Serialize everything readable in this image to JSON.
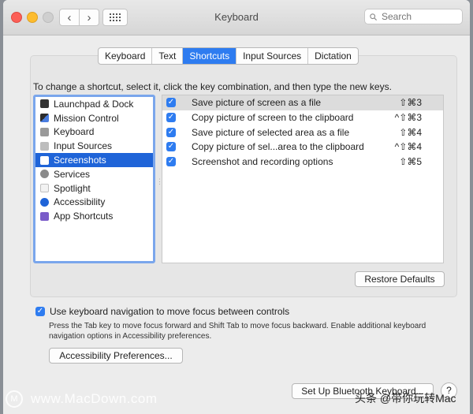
{
  "window": {
    "title": "Keyboard"
  },
  "search": {
    "placeholder": "Search"
  },
  "tabs": [
    {
      "label": "Keyboard"
    },
    {
      "label": "Text"
    },
    {
      "label": "Shortcuts"
    },
    {
      "label": "Input Sources"
    },
    {
      "label": "Dictation"
    }
  ],
  "instruction": "To change a shortcut, select it, click the key combination, and then type the new keys.",
  "categories": [
    {
      "label": "Launchpad & Dock",
      "icon": "launchpad-icon",
      "color": "#333333"
    },
    {
      "label": "Mission Control",
      "icon": "mission-control-icon",
      "color": "#2b2b2b"
    },
    {
      "label": "Keyboard",
      "icon": "keyboard-icon",
      "color": "#9a9a9a"
    },
    {
      "label": "Input Sources",
      "icon": "input-sources-icon",
      "color": "#bdbdbd"
    },
    {
      "label": "Screenshots",
      "icon": "screenshots-icon",
      "color": "#ffffff"
    },
    {
      "label": "Services",
      "icon": "gear-icon",
      "color": "#8a8a8a"
    },
    {
      "label": "Spotlight",
      "icon": "document-icon",
      "color": "#e0e0e0"
    },
    {
      "label": "Accessibility",
      "icon": "accessibility-icon",
      "color": "#1f64d8"
    },
    {
      "label": "App Shortcuts",
      "icon": "app-shortcuts-icon",
      "color": "#7a5cc9"
    }
  ],
  "selected_category": "Screenshots",
  "shortcuts": [
    {
      "name": "Save picture of screen as a file",
      "keys": "⇧⌘3",
      "checked": true
    },
    {
      "name": "Copy picture of screen to the clipboard",
      "keys": "^⇧⌘3",
      "checked": true
    },
    {
      "name": "Save picture of selected area as a file",
      "keys": "⇧⌘4",
      "checked": true
    },
    {
      "name": "Copy picture of sel...area to the clipboard",
      "keys": "^⇧⌘4",
      "checked": true
    },
    {
      "name": "Screenshot and recording options",
      "keys": "⇧⌘5",
      "checked": true
    }
  ],
  "buttons": {
    "restore_defaults": "Restore Defaults",
    "accessibility_prefs": "Accessibility Preferences...",
    "bluetooth": "Set Up Bluetooth Keyboard...",
    "help": "?"
  },
  "keyboard_nav": {
    "label": "Use keyboard navigation to move focus between controls",
    "checked": true,
    "note": "Press the Tab key to move focus forward and Shift Tab to move focus backward. Enable additional keyboard navigation options in Accessibility preferences."
  },
  "watermark": {
    "left": "www.MacDown.com",
    "right": "头条 @带你玩转Mac"
  },
  "colors": {
    "accent": "#2e7cf0",
    "selection": "#1f64d8"
  }
}
